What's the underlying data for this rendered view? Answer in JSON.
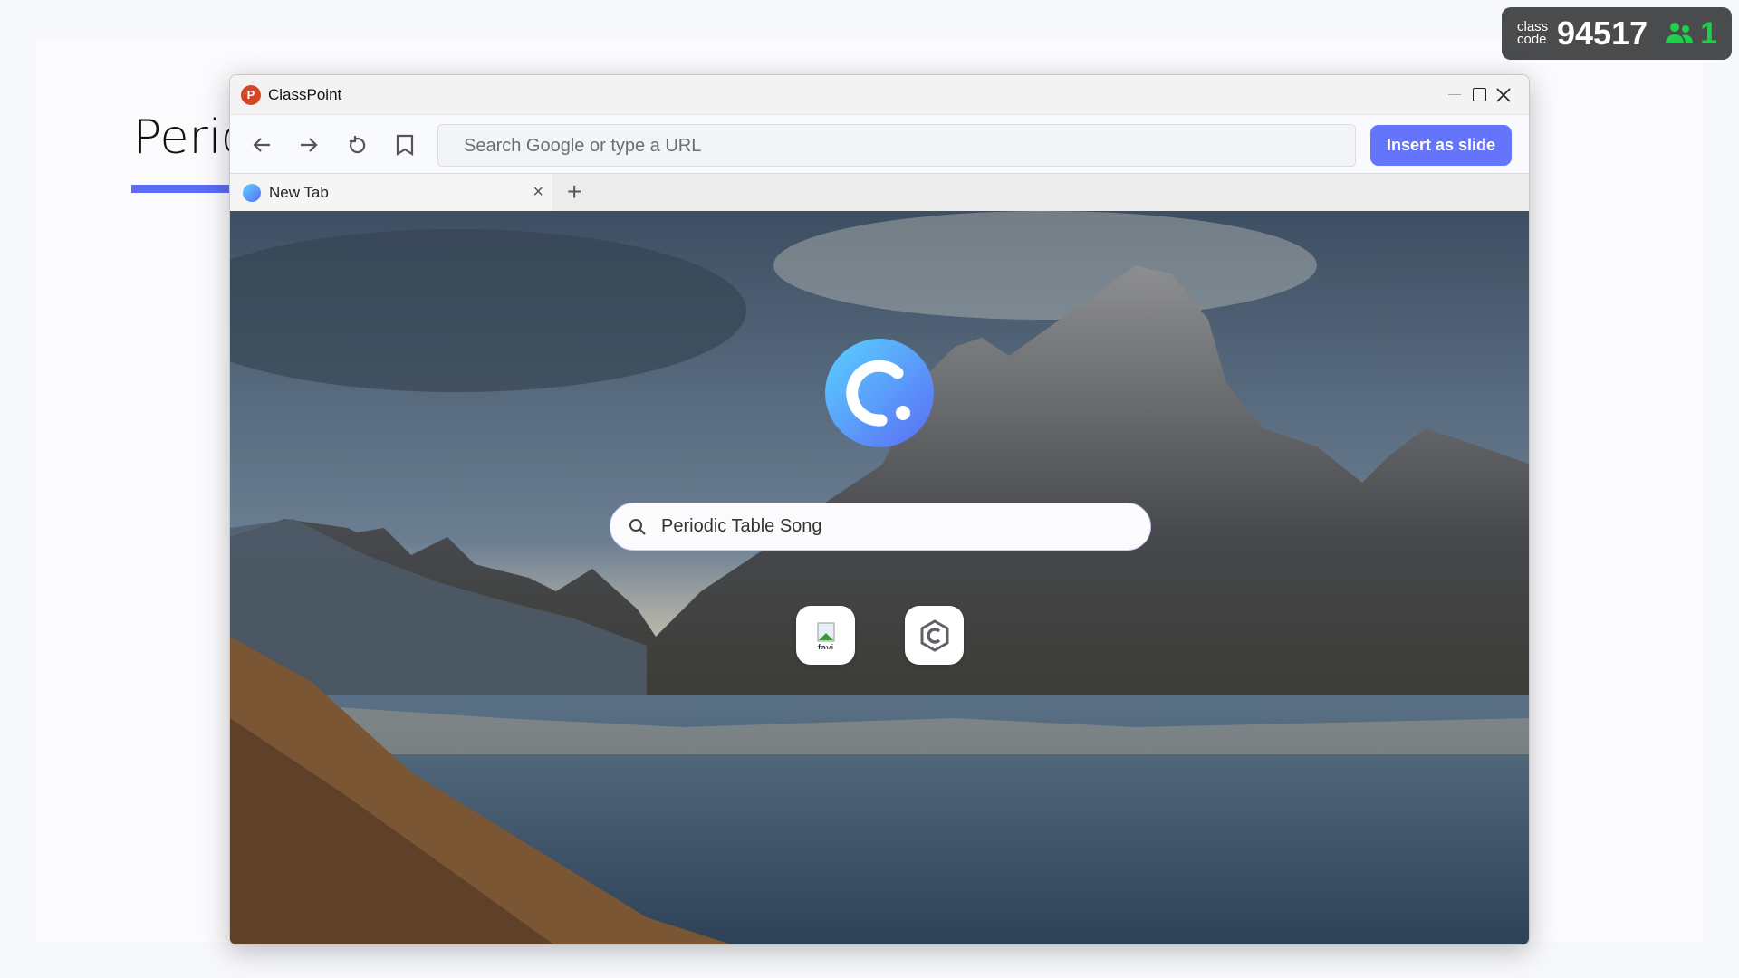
{
  "slide": {
    "title": "Peric",
    "accent": "#5b6cf5"
  },
  "badge": {
    "label_line1": "class",
    "label_line2": "code",
    "code": "94517",
    "participants": "1",
    "participants_color": "#1fd04a"
  },
  "window": {
    "title": "ClassPoint",
    "app_icon_letter": "P"
  },
  "toolbar": {
    "address_placeholder": "Search Google or type a URL",
    "insert_label": "Insert as slide",
    "insert_color": "#6475fb"
  },
  "tabs": [
    {
      "label": "New Tab",
      "close": "×"
    }
  ],
  "new_tab": "+",
  "newtab_page": {
    "search_value": "Periodic Table Song",
    "shortcuts": [
      {
        "icon": "broken-image-icon",
        "label": "favi"
      },
      {
        "icon": "classpoint-hex-icon"
      }
    ]
  }
}
